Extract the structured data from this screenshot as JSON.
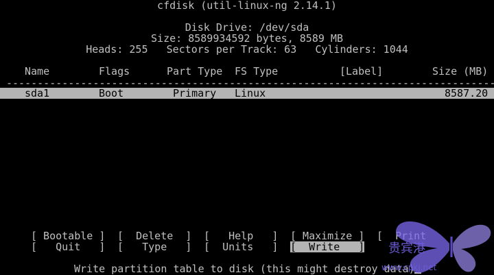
{
  "header": {
    "title": "cfdisk (util-linux-ng 2.14.1)",
    "disk_drive": "Disk Drive: /dev/sda",
    "size": "Size: 8589934592 bytes, 8589 MB",
    "geometry": "Heads: 255   Sectors per Track: 63   Cylinders: 1044"
  },
  "table": {
    "columns": [
      "Name",
      "Flags",
      "Part Type",
      "FS Type",
      "[Label]",
      "Size (MB)"
    ],
    "separator": "--------------------------------------------------------------------------------------",
    "rows": [
      {
        "name": "sda1",
        "flags": "Boot",
        "part_type": "Primary",
        "fs_type": "Linux",
        "label": "",
        "size": "8587.20"
      }
    ]
  },
  "menu": {
    "items_row1": [
      "[ Bootable ]",
      "[  Delete  ]",
      "[   Help   ]",
      "[ Maximize ]",
      "[  Print"
    ],
    "items_row2": [
      "[   Quit   ]",
      "[   Type   ]",
      "[  Units   ]",
      "[  Write   ]"
    ],
    "active_item": "[  Write   ]"
  },
  "status": {
    "message": "Write partition table to disk (this might destroy data)"
  },
  "watermark": {
    "text": "贵宾港",
    "url": "www.cpkj.net"
  },
  "colors": {
    "background": "#000000",
    "foreground": "#c0c0c0",
    "highlight": "#b4b4b4"
  }
}
